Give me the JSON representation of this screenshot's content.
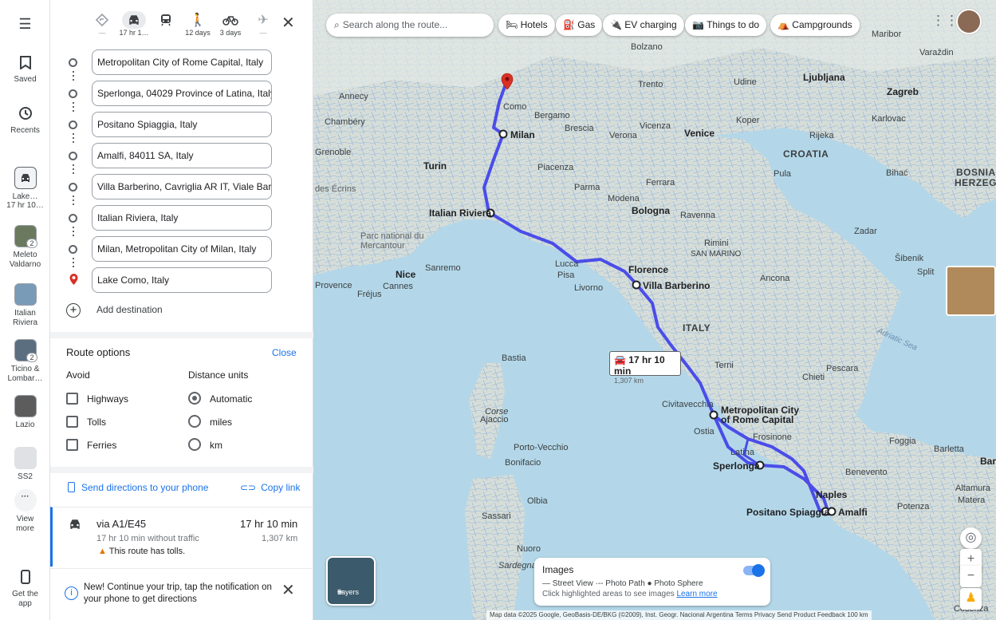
{
  "rail": {
    "menu_icon": "menu-icon",
    "saved": "Saved",
    "recents": "Recents",
    "trip_label": "Lake…",
    "trip_time": "17 hr 10…",
    "items": [
      {
        "label": "Meleto Valdarno",
        "count": "2"
      },
      {
        "label": "Italian Riviera",
        "count": ""
      },
      {
        "label": "Ticino & Lombar…",
        "count": "2"
      },
      {
        "label": "Lazio",
        "count": ""
      },
      {
        "label": "SS2",
        "count": ""
      }
    ],
    "view_more": "View more",
    "get_app": "Get the app"
  },
  "modes": {
    "best": "—",
    "drive": "17 hr 1…",
    "transit": "",
    "walk": "12 days",
    "bike": "3 days",
    "flight": "—"
  },
  "stops": [
    "Metropolitan City of Rome Capital, Italy",
    "Sperlonga, 04029 Province of Latina, Italy",
    "Positano Spiaggia, Italy",
    "Amalfi, 84011 SA, Italy",
    "Villa Barberino, Cavriglia AR IT, Viale Barberino",
    "Italian Riviera, Italy",
    "Milan, Metropolitan City of Milan, Italy",
    "Lake Como, Italy"
  ],
  "add_destination": "Add destination",
  "route_options": {
    "title": "Route options",
    "close": "Close",
    "avoid_label": "Avoid",
    "avoid": [
      "Highways",
      "Tolls",
      "Ferries"
    ],
    "units_label": "Distance units",
    "units": [
      "Automatic",
      "miles",
      "km"
    ],
    "selected_unit": "Automatic"
  },
  "actions": {
    "send": "Send directions to your phone",
    "copy": "Copy link"
  },
  "route": {
    "via": "via A1/E45",
    "time": "17 hr 10 min",
    "sub": "17 hr 10 min without traffic",
    "dist": "1,307 km",
    "warn": "This route has tolls."
  },
  "notice": {
    "text": "New! Continue your trip, tap the notification on your phone to get directions"
  },
  "map": {
    "search_placeholder": "Search along the route...",
    "chips": [
      "Hotels",
      "Gas",
      "EV charging",
      "Things to do",
      "Campgrounds"
    ],
    "callout_time": "17 hr 10 min",
    "callout_dist": "1,307 km",
    "layers": "Layers",
    "images": {
      "title": "Images",
      "legend": "— Street View  ·-- Photo Path  ● Photo Sphere",
      "hint": "Click highlighted areas to see images",
      "learn": "Learn more"
    },
    "attribution": "Map data ©2025 Google, GeoBasis-DE/BKG (©2009), Inst. Geogr. Nacional   Argentina   Terms   Privacy   Send Product Feedback   100 km",
    "labels": {
      "milan": "Milan",
      "como": "Como",
      "bergamo": "Bergamo",
      "brescia": "Brescia",
      "verona": "Verona",
      "vicenza": "Vicenza",
      "venice": "Venice",
      "turin": "Turin",
      "piacenza": "Piacenza",
      "parma": "Parma",
      "modena": "Modena",
      "ferrara": "Ferrara",
      "bologna": "Bologna",
      "ravenna": "Ravenna",
      "rimini": "Rimini",
      "italian_riviera": "Italian Riviera",
      "nice": "Nice",
      "cannes": "Cannes",
      "lucca": "Lucca",
      "pisa": "Pisa",
      "livorno": "Livorno",
      "florence": "Florence",
      "villa_barberino": "Villa Barberino",
      "san_marino": "SAN MARINO",
      "ancona": "Ancona",
      "italy": "ITALY",
      "terni": "Terni",
      "pescara": "Pescara",
      "chieti": "Chieti",
      "civitavecchia": "Civitavecchia",
      "rome": "Metropolitan City of Rome Capital",
      "ostia": "Ostia",
      "latina": "Latina",
      "frosinone": "Frosinone",
      "sperlonga": "Sperlonga",
      "naples": "Naples",
      "positano": "Positano Spiaggia",
      "amalfi": "Amalfi",
      "foggia": "Foggia",
      "barletta": "Barletta",
      "bari": "Bari",
      "benevento": "Benevento",
      "potenza": "Potenza",
      "bastia": "Bastia",
      "corse": "Corse",
      "ajaccio": "Ajaccio",
      "porto_vecchio": "Porto-Vecchio",
      "bonifacio": "Bonifacio",
      "olbia": "Olbia",
      "sassari": "Sassari",
      "nuoro": "Nuoro",
      "sardegna": "Sardegna",
      "ljubljana": "Ljubljana",
      "zagreb": "Zagreb",
      "croatia": "CROATIA",
      "rijeka": "Rijeka",
      "pula": "Pula",
      "udine": "Udine",
      "bolzano": "Bolzano",
      "trento": "Trento",
      "grenoble": "Grenoble",
      "chambery": "Chambéry",
      "annecy": "Annecy",
      "adriatic": "Adriatic Sea",
      "zadar": "Zadar",
      "bosnia": "BOSNIA",
      "herzeg": "HERZEG",
      "altamura": "Altamura",
      "matera": "Matera",
      "cosenza": "Cosenza",
      "karlovac": "Karlovac",
      "koper": "Koper",
      "sibenik": "Šibenik",
      "split": "Split",
      "bihac": "Bihać",
      "mercantour": "Parc national du Mercantour",
      "ecrins": "des Écrins",
      "sanremo": "Sanremo",
      "frejus": "Fréjus",
      "provence": "Provence",
      "varazdin": "Varaždin",
      "maribor": "Maribor"
    }
  },
  "colors": {
    "accent": "#1a73e8",
    "route": "#4a4de8",
    "route_alt": "#7c8df0",
    "land": "#d4ddd6",
    "water": "#b3d7e8",
    "roads": "#7fa9d6",
    "pin": "#d93025"
  }
}
